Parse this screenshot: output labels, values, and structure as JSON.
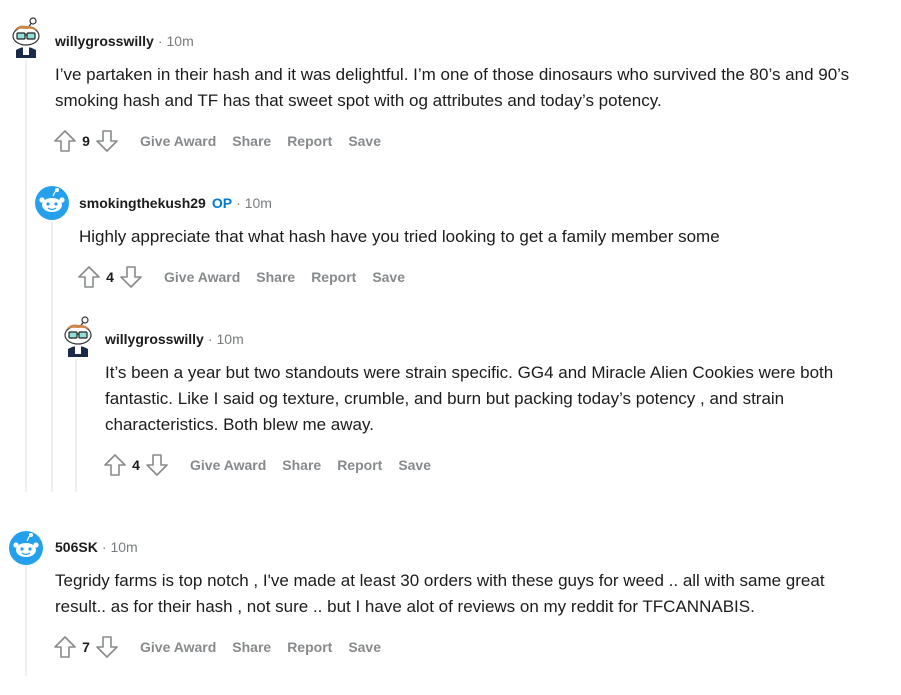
{
  "comments": [
    {
      "author": "willygrosswilly",
      "op_badge": "",
      "separator": "·",
      "time": "10m",
      "body": "I’ve partaken in their hash and it was delightful. I’m one of those dinosaurs who survived the 80’s and 90’s smoking hash and TF has that sweet spot with og attributes and today’s potency.",
      "score": "9",
      "avatar_icon": "snoo-glasses-avatar-icon"
    },
    {
      "author": "smokingthekush29",
      "op_badge": "OP",
      "separator": "·",
      "time": "10m",
      "body": "Highly appreciate that what hash have you tried looking to get a family member some",
      "score": "4",
      "avatar_icon": "snoo-default-avatar-icon"
    },
    {
      "author": "willygrosswilly",
      "op_badge": "",
      "separator": "·",
      "time": "10m",
      "body": "It’s been a year but two standouts were strain specific. GG4 and Miracle Alien Cookies were both fantastic. Like I said og texture, crumble, and burn but packing today’s potency , and strain characteristics. Both blew me away.",
      "score": "4",
      "avatar_icon": "snoo-glasses-avatar-icon"
    },
    {
      "author": "506SK",
      "op_badge": "",
      "separator": "·",
      "time": "10m",
      "body": "Tegridy farms is top notch , I've made at least 30 orders with these guys for weed .. all with same great result.. as for their hash , not sure .. but I have alot of reviews on my reddit for TFCANNABIS.",
      "score": "7",
      "avatar_icon": "snoo-default-avatar-icon"
    }
  ],
  "actions": {
    "give_award": "Give Award",
    "share": "Share",
    "report": "Report",
    "save": "Save"
  },
  "colors": {
    "author": "#1c1c1c",
    "op": "#0079d3",
    "meta": "#787c7e",
    "action": "#878a8c",
    "thread_line": "#edeff1",
    "snoo_blue": "#24a0ed"
  }
}
